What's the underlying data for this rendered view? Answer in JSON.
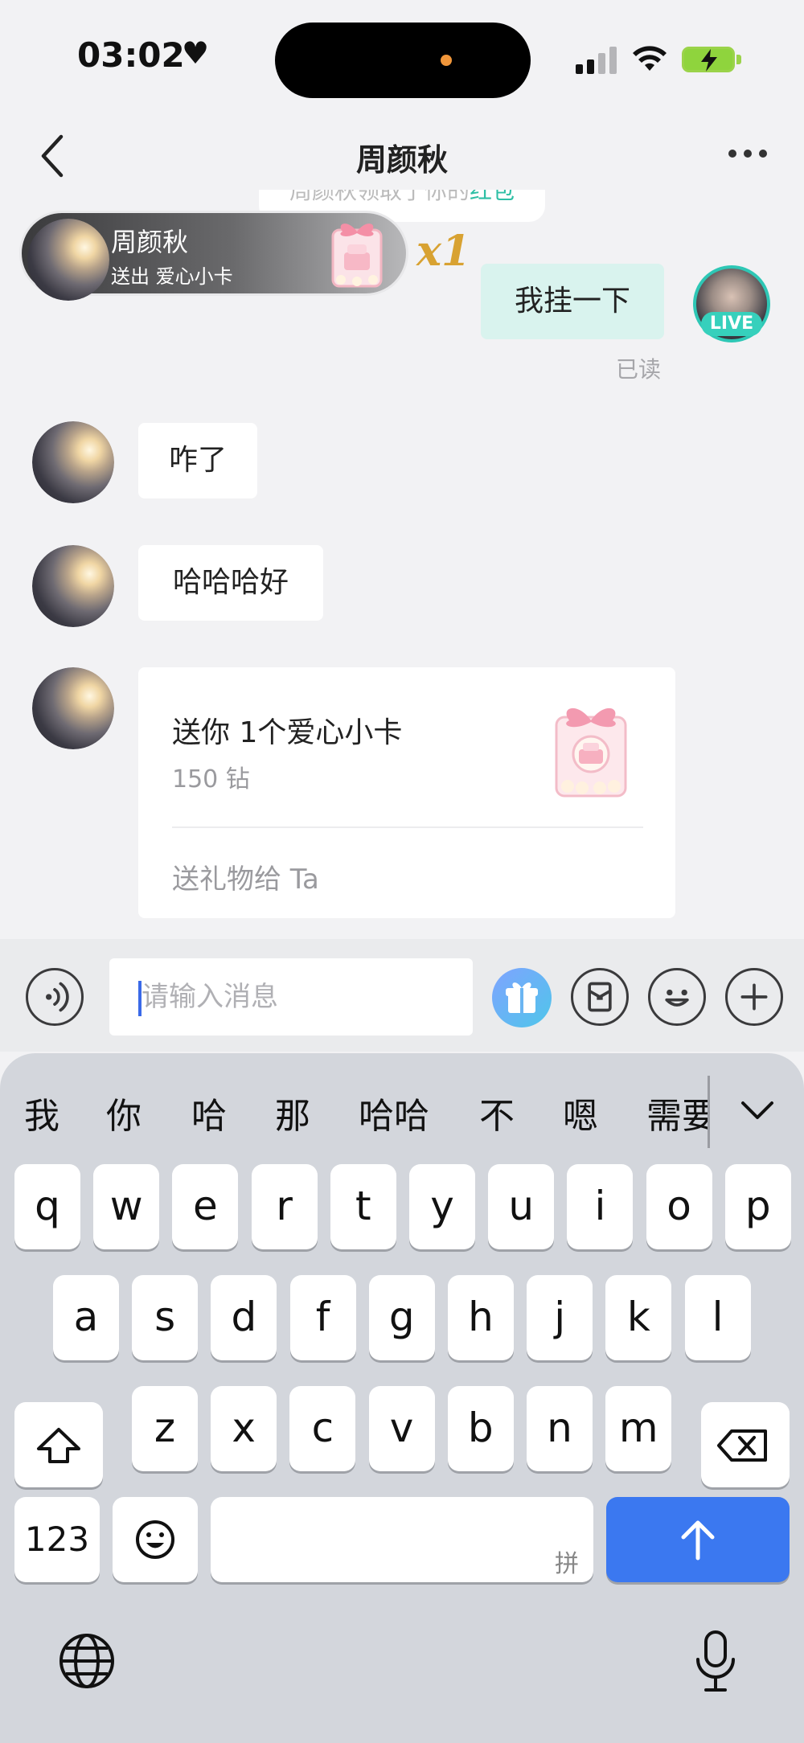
{
  "status_bar": {
    "time": "03:02",
    "heart": "♥"
  },
  "nav": {
    "title": "周颜秋"
  },
  "system_tip": {
    "text_prefix": "周颜秋领取了你的",
    "text_highlight": "红包"
  },
  "gift_toast": {
    "name": "周颜秋",
    "subtitle": "送出 爱心小卡",
    "count": "x1"
  },
  "messages": {
    "outgoing": {
      "text": "我挂一下",
      "read_status": "已读",
      "live_badge": "LIVE"
    },
    "incoming_1": "咋了",
    "incoming_2": "哈哈哈好",
    "gift_card": {
      "title": "送你 1个爱心小卡",
      "price": "150 钻",
      "action": "送礼物给 Ta"
    }
  },
  "input_bar": {
    "placeholder": "请输入消息"
  },
  "keyboard": {
    "candidates": [
      "我",
      "你",
      "哈",
      "那",
      "哈哈",
      "不",
      "嗯",
      "需要"
    ],
    "row1": [
      "q",
      "w",
      "e",
      "r",
      "t",
      "y",
      "u",
      "i",
      "o",
      "p"
    ],
    "row2": [
      "a",
      "s",
      "d",
      "f",
      "g",
      "h",
      "j",
      "k",
      "l"
    ],
    "row3": [
      "z",
      "x",
      "c",
      "v",
      "b",
      "n",
      "m"
    ],
    "numbers_label": "123",
    "space_hint": "拼"
  }
}
